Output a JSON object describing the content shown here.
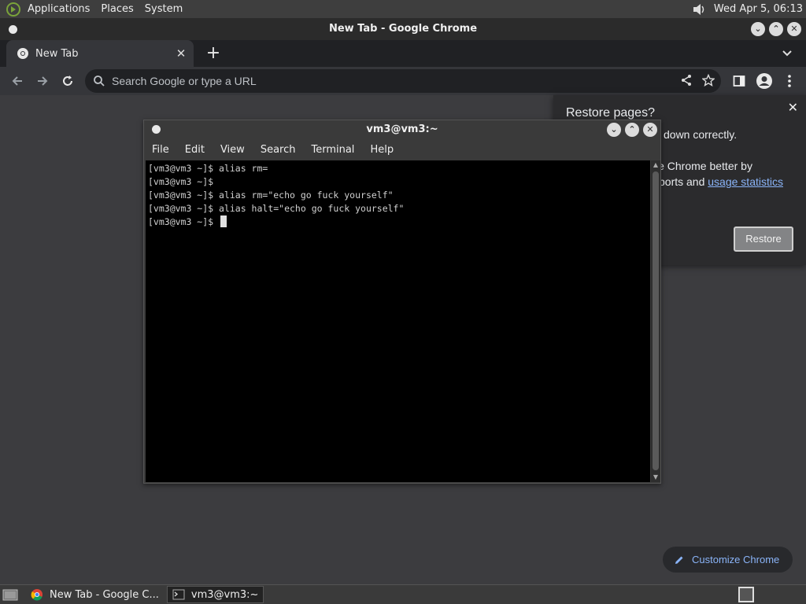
{
  "top_panel": {
    "menus": [
      "Applications",
      "Places",
      "System"
    ],
    "clock": "Wed Apr  5, 06:13",
    "icons": {
      "logo": "gnome-foot-icon",
      "volume": "volume-icon"
    }
  },
  "chrome": {
    "window_title": "New Tab - Google Chrome",
    "tab_label": "New Tab",
    "tab_close": "✕",
    "new_tab": "+",
    "omnibox_placeholder": "Search Google or type a URL",
    "customize_label": "Customize Chrome",
    "accent_color": "#8ab4f8"
  },
  "restore_popup": {
    "title": "Restore pages?",
    "line1": "down correctly.",
    "line2": "le Chrome better by",
    "line3": "ports and",
    "link": "usage statistics",
    "button": "Restore",
    "close": "✕"
  },
  "terminal": {
    "title": "vm3@vm3:~",
    "menus": [
      "File",
      "Edit",
      "View",
      "Search",
      "Terminal",
      "Help"
    ],
    "lines": [
      "[vm3@vm3 ~]$ alias rm=",
      "[vm3@vm3 ~]$",
      "[vm3@vm3 ~]$ alias rm=\"echo go fuck yourself\"",
      "[vm3@vm3 ~]$ alias halt=\"echo go fuck yourself\"",
      "[vm3@vm3 ~]$ "
    ]
  },
  "taskbar": {
    "items": [
      "New Tab - Google C...",
      "vm3@vm3:~"
    ]
  }
}
